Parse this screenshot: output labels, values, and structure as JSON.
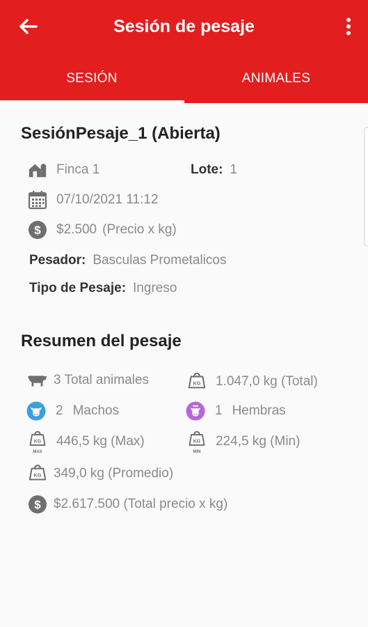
{
  "app_bar": {
    "title": "Sesión de pesaje"
  },
  "tabs": [
    {
      "label": "SESIÓN",
      "selected": true
    },
    {
      "label": "ANIMALES",
      "selected": false
    }
  ],
  "colors": {
    "primary": "#e21e1e",
    "male_icon": "#3aa0e0",
    "female_icon": "#b567d9",
    "icon_gray": "#6f6f6f"
  },
  "session": {
    "name": "SesiónPesaje_1 (Abierta)",
    "farm": "Finca 1",
    "lot_label": "Lote:",
    "lot": "1",
    "datetime": "07/10/2021 11:12",
    "price": "$2.500",
    "price_unit": "(Precio x kg)",
    "weigher_label": "Pesador:",
    "weigher": "Basculas Prometalicos",
    "type_label": "Tipo de Pesaje:",
    "type": "Ingreso"
  },
  "summary": {
    "heading": "Resumen del pesaje",
    "total_animals": "3 Total animales",
    "total_weight": "1.047,0 kg (Total)",
    "males_count": "2",
    "males_label": "Machos",
    "females_count": "1",
    "females_label": "Hembras",
    "max_weight": "446,5 kg (Max)",
    "min_weight": "224,5 kg (Min)",
    "avg_weight": "349,0 kg (Promedio)",
    "total_price": "$2.617.500 (Total precio x kg)"
  },
  "icons": {
    "back": "arrow-left-icon",
    "menu": "more-vert-icon",
    "farm": "farm-house-icon",
    "date": "calendar-icon",
    "price": "dollar-coin-icon",
    "cow": "cow-icon",
    "scale": "kg-weight-icon",
    "male": "bull-face-icon",
    "female": "cow-face-icon"
  }
}
